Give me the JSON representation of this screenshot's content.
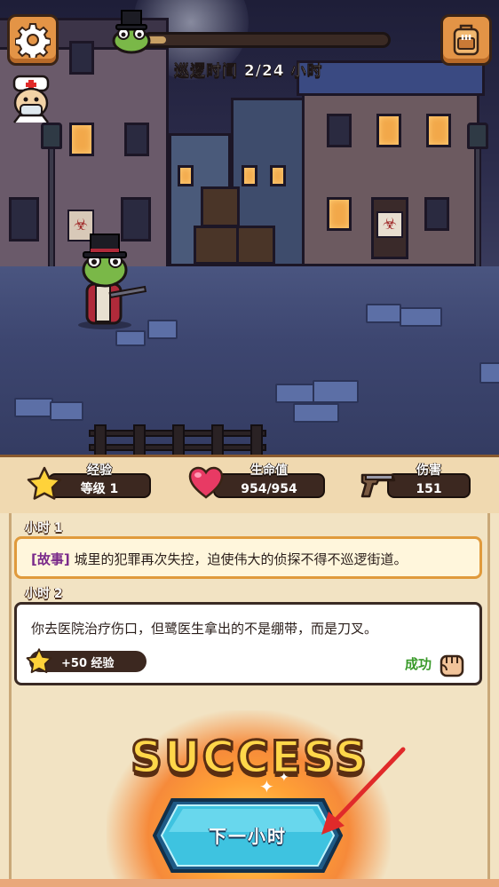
{
  "hud": {
    "patrol_time": "巡逻时间 2/24 小时",
    "progress": 0.0833
  },
  "stats": {
    "xp": {
      "title": "经验",
      "value": "等级 1"
    },
    "hp": {
      "title": "生命值",
      "value": "954/954"
    },
    "damage": {
      "title": "伤害",
      "value": "151"
    }
  },
  "log": {
    "hour1": {
      "label": "小时 1",
      "tag": "[故事]",
      "text": "城里的犯罪再次失控，迫使伟大的侦探不得不巡逻街道。"
    },
    "hour2": {
      "label": "小时 2",
      "text": "你去医院治疗伤口，但鹭医生拿出的不是绷带，而是刀叉。",
      "reward": "+50 经验",
      "result": "成功"
    }
  },
  "result_banner": "SUCCESS",
  "next_button": "下一小时",
  "colors": {
    "accent_orange": "#e39446",
    "panel_bg": "#f2e3c3",
    "button_cyan": "#3ec3e0",
    "success_green": "#3a9a2a",
    "story_tag": "#7a2a8a",
    "arrow_red": "#e02a2a"
  },
  "icons": {
    "settings": "gear-icon",
    "inventory": "backpack-icon",
    "xp": "star-icon",
    "hp": "heart-icon",
    "damage": "pistol-icon",
    "result": "fist-icon"
  }
}
